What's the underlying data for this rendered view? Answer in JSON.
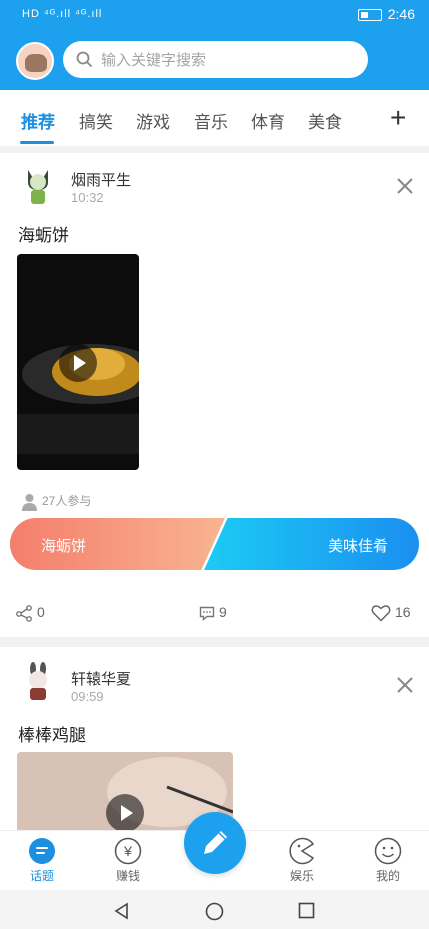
{
  "status_bar": {
    "left_text": "HD ⁴ᴳ.ıll ⁴ᴳ.ıll",
    "time": "2:46"
  },
  "header": {
    "search_placeholder": "输入关键字搜索"
  },
  "tabs": [
    "推荐",
    "搞笑",
    "游戏",
    "音乐",
    "体育",
    "美食"
  ],
  "posts": [
    {
      "user": "烟雨平生",
      "time": "10:32",
      "title": "海蛎饼",
      "participants": "27人参与",
      "vote_left": "海蛎饼",
      "vote_right": "美味佳肴",
      "shares": "0",
      "comments": "9",
      "likes": "16"
    },
    {
      "user": "轩辕华夏",
      "time": "09:59",
      "title": "棒棒鸡腿"
    }
  ],
  "bottom_nav": [
    "话题",
    "赚钱",
    "娱乐",
    "我的"
  ],
  "colors": {
    "brand": "#1da1ee",
    "vote_left": "#f47e6c",
    "vote_right": "#1a8ff0"
  }
}
